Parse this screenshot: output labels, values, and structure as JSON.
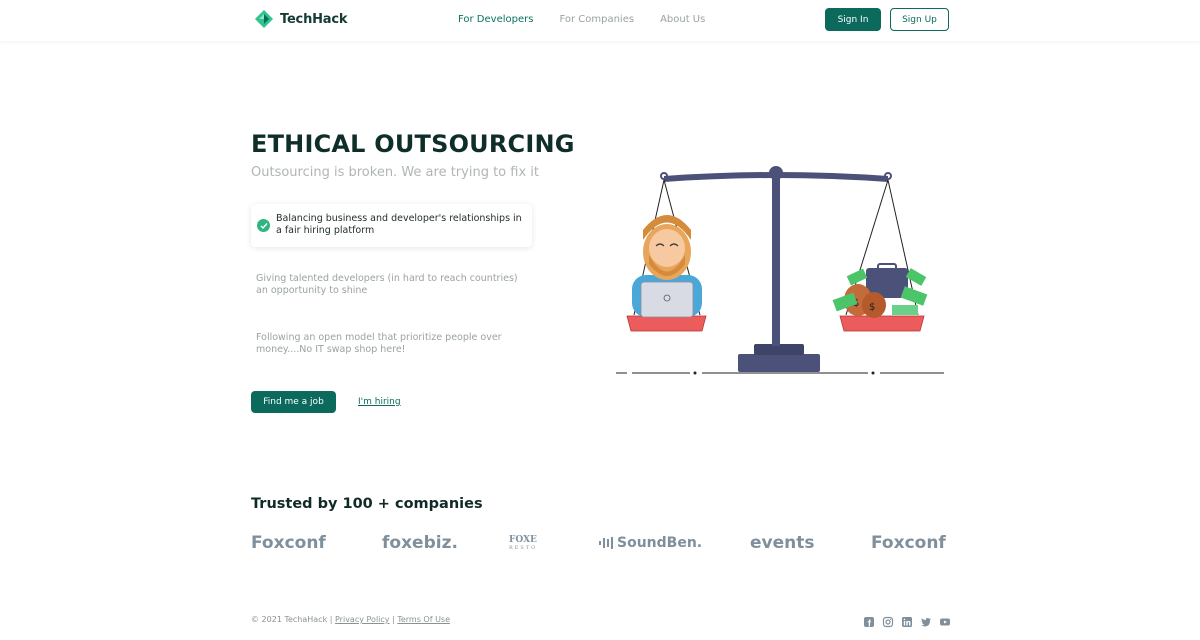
{
  "header": {
    "brand": "TechHack",
    "nav": [
      "For Developers",
      "For Companies",
      "About Us"
    ],
    "signin_label": "Sign In",
    "signup_label": "Sign Up"
  },
  "hero": {
    "title": "ETHICAL OUTSOURCING",
    "subtitle": "Outsourcing is broken. We are trying to fix it",
    "features": [
      "Balancing business and developer's relationships in a fair hiring platform",
      "Giving talented developers (in hard to reach countries) an opportunity to shine",
      "Following an open model that prioritize people over money....No IT swap shop here!"
    ],
    "primary_cta": "Find me a job",
    "secondary_cta": "I'm hiring"
  },
  "trusted": {
    "title": "Trusted by 100 + companies",
    "brands": [
      "Foxconf",
      "foxebiz.",
      "FOXE",
      "RESTO",
      "SoundBen.",
      "events",
      "Foxconf"
    ]
  },
  "footer": {
    "copyright": "© 2021 TechaHack | ",
    "privacy": "Privacy Policy",
    "separator": " | ",
    "terms": "Terms Of Use",
    "social_icons": [
      "facebook-icon",
      "instagram-icon",
      "linkedin-icon",
      "twitter-icon",
      "youtube-icon"
    ]
  },
  "colors": {
    "brand": "#0b6a5c",
    "accent": "#2fb57f",
    "muted": "#9aa3a1",
    "logo_gray": "#7f909c"
  }
}
